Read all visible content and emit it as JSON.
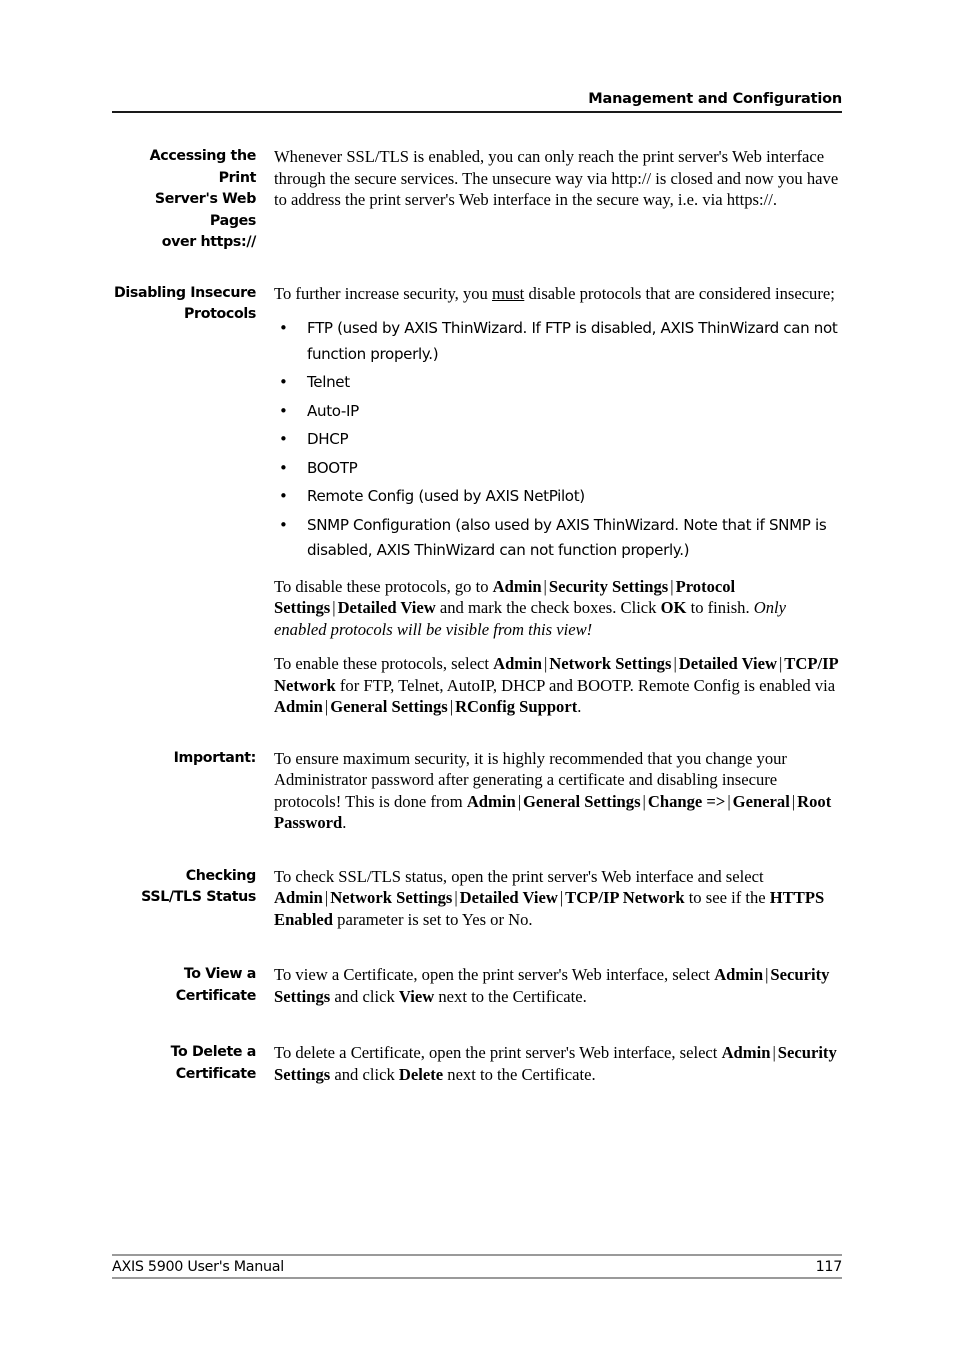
{
  "header": {
    "running_head": "Management and Configuration"
  },
  "sections": [
    {
      "label": "Accessing the Print Server's Web Pages over https://",
      "label_lines": [
        "Accessing the Print",
        "Server's Web Pages",
        "over https://"
      ],
      "paragraphs": [
        "Whenever SSL/TLS is enabled, you can only reach the print server's Web interface through the secure services. The unsecure way via http:// is closed and now you have to address the print server's Web interface in the secure way, i.e. via https://."
      ]
    },
    {
      "label": "Disabling Insecure Protocols",
      "label_lines": [
        "Disabling Insecure",
        "Protocols"
      ],
      "intro_before_must": "To further increase security, you ",
      "intro_must": "must",
      "intro_after_must": " disable protocols that are considered insecure;",
      "bullets": [
        "FTP (used by AXIS ThinWizard. If FTP is disabled, AXIS ThinWizard can not function properly.)",
        "Telnet",
        "Auto-IP",
        "DHCP",
        "BOOTP",
        "Remote Config (used by AXIS NetPilot)",
        "SNMP Configuration (also used by AXIS ThinWizard. Note that if SNMP is disabled, AXIS ThinWizard can not function properly.)"
      ],
      "disable_para": {
        "t1": "To disable these protocols, go to ",
        "b1": "Admin",
        "sep1": "|",
        "b2": "Security Settings",
        "sep2": "|",
        "b3": "Protocol Settings",
        "sep3": "|",
        "b4": "Detailed View",
        "t2": " and mark the check boxes. Click ",
        "b5": "OK",
        "t3": " to finish. ",
        "italic": "Only enabled protocols will be visible from this view!"
      },
      "enable_para": {
        "t1": "To enable these protocols, select ",
        "b1": "Admin",
        "sep1": "|",
        "b2": "Network Settings",
        "sep2": "|",
        "b3": "Detailed View",
        "sep3": "|",
        "b4": "TCP/IP Network",
        "t2": " for FTP, Telnet, AutoIP, DHCP and BOOTP. Remote Config is enabled via ",
        "b5": "Admin",
        "sep4": "|",
        "b6": "General Settings",
        "sep5": "|",
        "b7": "RConfig Support",
        "t3": "."
      }
    },
    {
      "label": "Important:",
      "label_lines": [
        "Important:"
      ],
      "para": {
        "t1": "To ensure maximum security, it is highly recommended that you change your Administrator password after generating a certificate and disabling insecure protocols! This is done from ",
        "b1": "Admin",
        "sep1": "|",
        "b2": "General Settings",
        "sep2": "|",
        "b3": "Change =>",
        "sep3": "|",
        "b4": "General",
        "sep4": "|",
        "b5": "Root Password",
        "t2": "."
      }
    },
    {
      "label": "Checking SSL/TLS Status",
      "label_lines": [
        "Checking",
        "SSL/TLS Status"
      ],
      "para": {
        "t1": "To check SSL/TLS status, open the print server's Web interface and select ",
        "b1": "Admin",
        "sep1": "|",
        "b2": "Network Settings",
        "sep2": "|",
        "b3": "Detailed View",
        "sep3": "|",
        "b4": "TCP/IP Network",
        "t2": " to see if the ",
        "b5": "HTTPS Enabled",
        "t3": " parameter is set to Yes or No."
      }
    },
    {
      "label": "To View a Certificate",
      "label_lines": [
        "To View a Certificate"
      ],
      "para": {
        "t1": "To view a Certificate, open the print server's Web interface, select ",
        "b1": "Admin",
        "sep1": "|",
        "b2": "Security Settings",
        "t2": " and click ",
        "b3": "View",
        "t3": " next to the Certificate."
      }
    },
    {
      "label": "To Delete a Certificate",
      "label_lines": [
        "To Delete a Certificate"
      ],
      "para": {
        "t1": "To delete a Certificate, open the print server's Web interface, select ",
        "b1": "Admin",
        "sep1": "|",
        "b2": "Security Settings",
        "t2": " and click ",
        "b3": "Delete",
        "t3": " next to the Certificate."
      }
    }
  ],
  "footer": {
    "manual_title": "AXIS 5900 User's Manual",
    "page_number": "117"
  },
  "colors": {
    "text": "#000000",
    "header_rule": "#1a1a1a",
    "footer_rule": "#9a9a9a"
  }
}
